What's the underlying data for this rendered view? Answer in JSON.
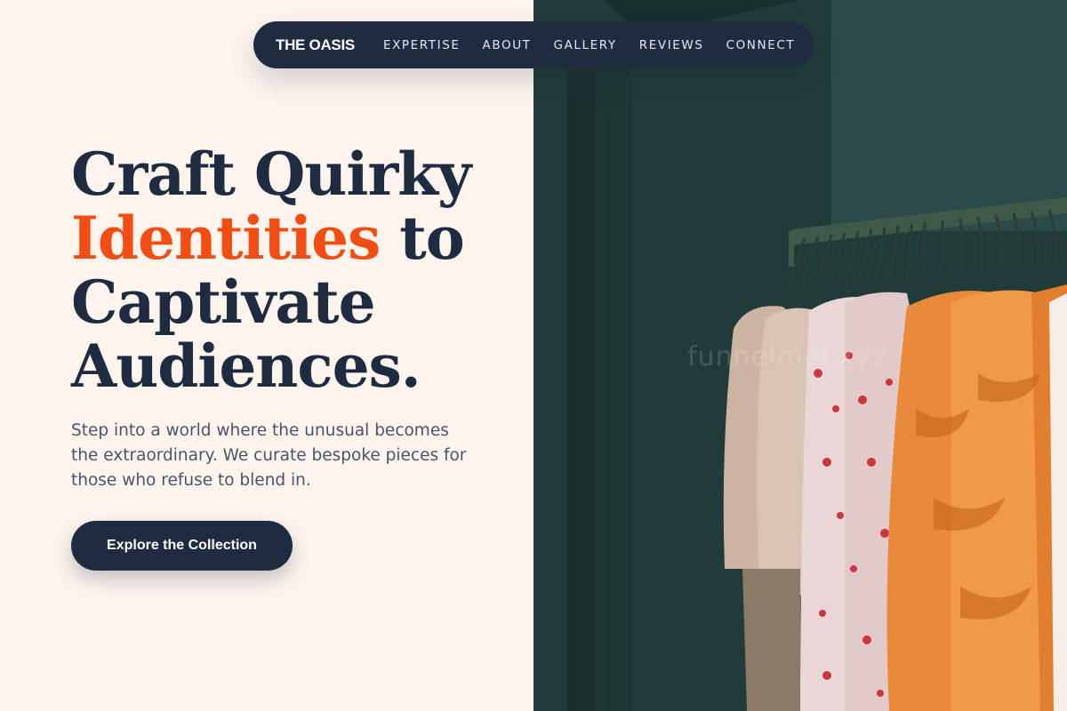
{
  "brand": "THE OASIS",
  "nav": [
    "EXPERTISE",
    "ABOUT",
    "GALLERY",
    "REVIEWS",
    "CONNECT"
  ],
  "hero": {
    "line1": "Craft Quirky",
    "line2_accent": "Identities",
    "line2_rest": " to",
    "line3": "Captivate",
    "line4": "Audiences.",
    "subtext": "Step into a world where the unusual becomes the extraordinary. We curate bespoke pieces for those who refuse to blend in.",
    "cta": "Explore the Collection"
  },
  "watermark": "funnelmel.xyz",
  "colors": {
    "navy": "#1f2b40",
    "accent": "#f24d12",
    "cream": "#fdf4ee",
    "body_text": "#4a5468"
  }
}
